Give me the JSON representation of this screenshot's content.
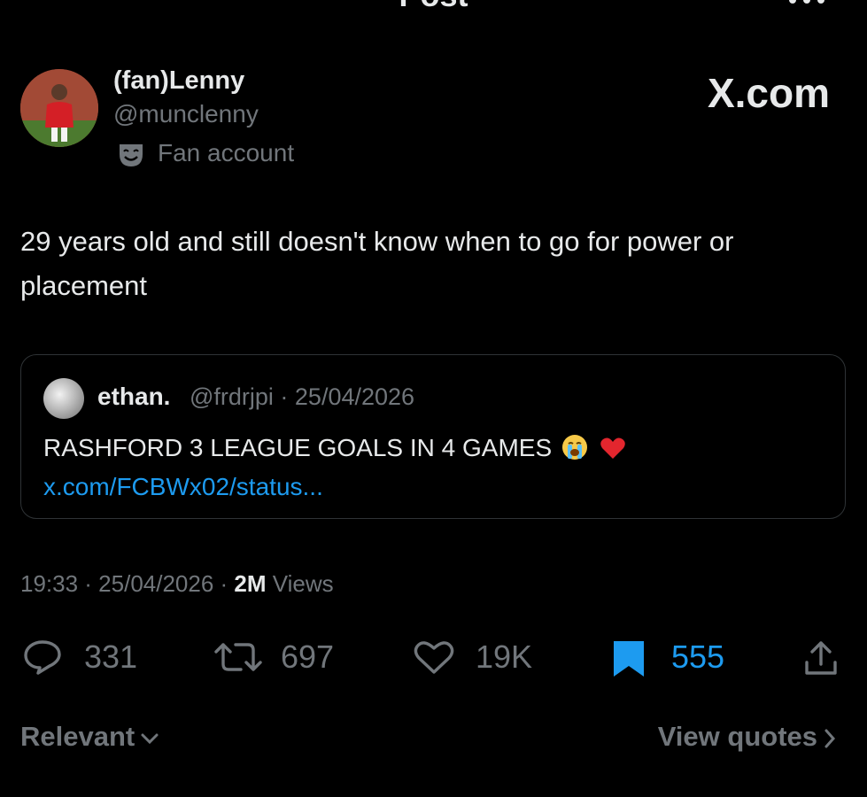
{
  "header": {
    "title": "Post"
  },
  "author": {
    "name": "(fan)Lenny",
    "handle": "@munclenny",
    "badge": "Fan account",
    "badge_icon": "theater-mask-icon"
  },
  "watermark": "X.com",
  "post": {
    "text": "29 years old and still doesn't know when to go for power or placement"
  },
  "quote": {
    "name": "ethan.",
    "meta": "@frdrjpi · 25/04/2026",
    "text": "RASHFORD 3 LEAGUE GOALS IN 4 GAMES",
    "emojis": [
      "loudly-crying-face",
      "red-heart"
    ],
    "link": "x.com/FCBWx02/status..."
  },
  "meta": {
    "time_date": "19:33 · 25/04/2026 · ",
    "views_count": "2M",
    "views_label": " Views"
  },
  "actions": {
    "replies": "331",
    "reposts": "697",
    "likes": "19K",
    "bookmarks": "555"
  },
  "footer": {
    "sort_label": "Relevant",
    "view_quotes_label": "View quotes"
  },
  "colors": {
    "background": "#000000",
    "text_primary": "#e7e9ea",
    "text_secondary": "#71767b",
    "accent_blue": "#1d9bf0",
    "border": "#2f3336"
  }
}
